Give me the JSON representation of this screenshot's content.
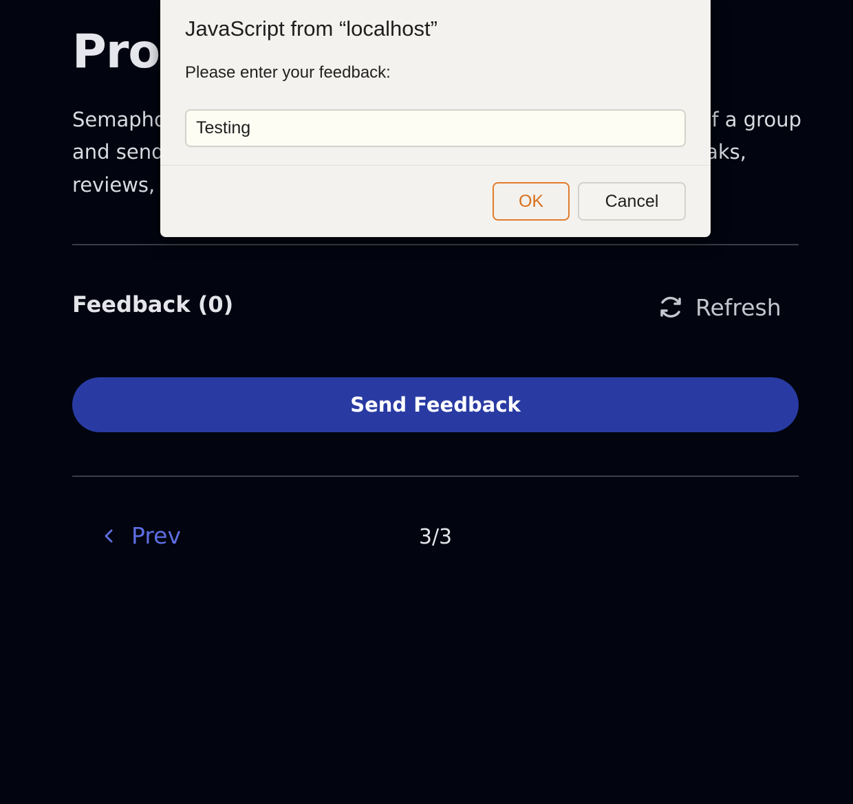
{
  "page": {
    "title": "Proc",
    "description_lines": {
      "line1_left": "Semapho",
      "line1_right": "f a group",
      "line2_left": "and send",
      "line2_right": "aks,",
      "line3_left": "reviews, f"
    }
  },
  "feedback": {
    "title": "Feedback (0)",
    "refresh_label": "Refresh",
    "send_button_label": "Send Feedback"
  },
  "pagination": {
    "prev_label": "Prev",
    "counter": "3/3"
  },
  "dialog": {
    "title": "JavaScript from “localhost”",
    "message": "Please enter your feedback:",
    "input_value": "Testing",
    "ok_label": "OK",
    "cancel_label": "Cancel"
  },
  "colors": {
    "background": "#02040f",
    "primary_button": "#293ba3",
    "link": "#5e6ee3",
    "dialog_accent": "#e07b2b"
  },
  "icons": {
    "refresh": "refresh-icon",
    "prev": "chevron-left-icon"
  }
}
